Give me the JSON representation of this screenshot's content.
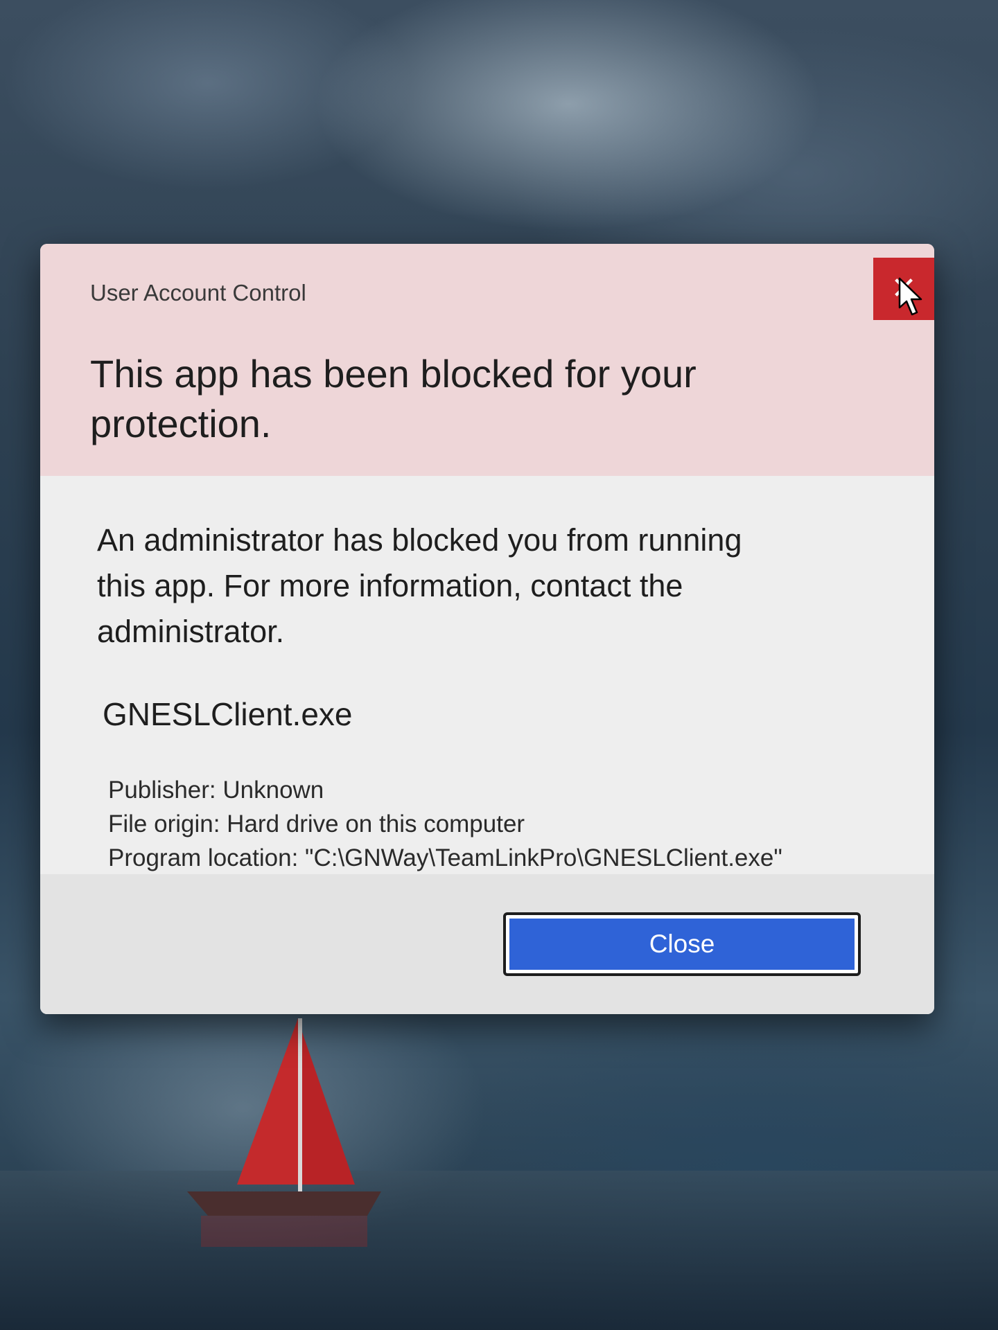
{
  "dialog": {
    "window_title": "User Account Control",
    "headline": "This app has been blocked for your protection.",
    "message": "An administrator has blocked you from running this app. For more information, contact the administrator.",
    "filename": "GNESLClient.exe",
    "details": {
      "publisher": "Publisher: Unknown",
      "file_origin": "File origin: Hard drive on this computer",
      "program_location": "Program location: \"C:\\GNWay\\TeamLinkPro\\GNESLClient.exe\""
    },
    "close_button_label": "Close",
    "title_close_glyph": "✕"
  },
  "colors": {
    "header_background": "#eed6d8",
    "dialog_background": "#eeeeee",
    "close_button": "#2f63d7",
    "title_close_button": "#c9282d"
  },
  "icons": {
    "title_close": "close-icon",
    "pointer": "mouse-pointer-icon"
  }
}
